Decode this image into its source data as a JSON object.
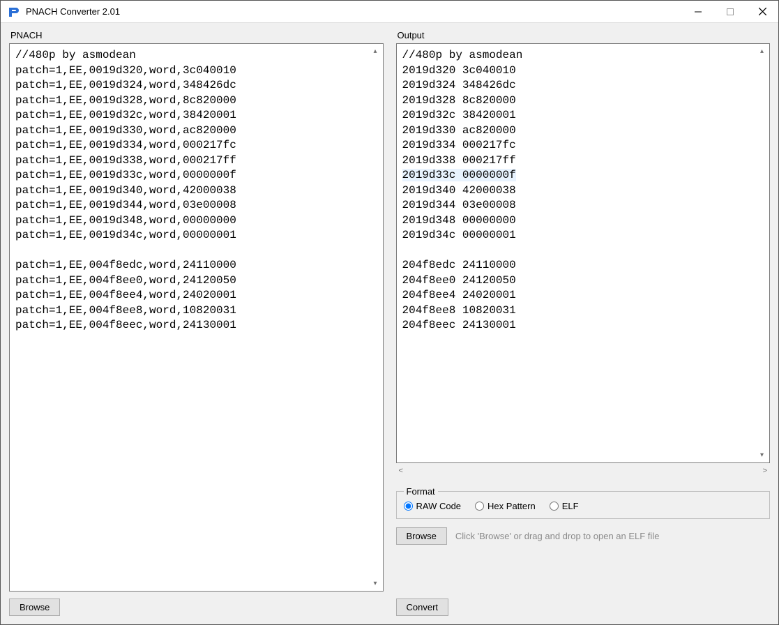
{
  "window": {
    "title": "PNACH Converter 2.01"
  },
  "left_panel": {
    "label": "PNACH",
    "content": "//480p by asmodean\npatch=1,EE,0019d320,word,3c040010\npatch=1,EE,0019d324,word,348426dc\npatch=1,EE,0019d328,word,8c820000\npatch=1,EE,0019d32c,word,38420001\npatch=1,EE,0019d330,word,ac820000\npatch=1,EE,0019d334,word,000217fc\npatch=1,EE,0019d338,word,000217ff\npatch=1,EE,0019d33c,word,0000000f\npatch=1,EE,0019d340,word,42000038\npatch=1,EE,0019d344,word,03e00008\npatch=1,EE,0019d348,word,00000000\npatch=1,EE,0019d34c,word,00000001\n\npatch=1,EE,004f8edc,word,24110000\npatch=1,EE,004f8ee0,word,24120050\npatch=1,EE,004f8ee4,word,24020001\npatch=1,EE,004f8ee8,word,10820031\npatch=1,EE,004f8eec,word,24130001",
    "browse_label": "Browse"
  },
  "right_panel": {
    "label": "Output",
    "content_pre": "//480p by asmodean\n2019d320 3c040010\n2019d324 348426dc\n2019d328 8c820000\n2019d32c 38420001\n2019d330 ac820000\n2019d334 000217fc\n2019d338 000217ff",
    "content_hl": "2019d33c 0000000f",
    "content_post": "2019d340 42000038\n2019d344 03e00008\n2019d348 00000000\n2019d34c 00000001\n\n204f8edc 24110000\n204f8ee0 24120050\n204f8ee4 24020001\n204f8ee8 10820031\n204f8eec 24130001",
    "convert_label": "Convert"
  },
  "format": {
    "legend": "Format",
    "options": {
      "raw": "RAW Code",
      "hex": "Hex Pattern",
      "elf": "ELF"
    },
    "selected": "raw"
  },
  "elf": {
    "browse_label": "Browse",
    "hint": "Click 'Browse' or drag and drop to open an ELF file"
  }
}
